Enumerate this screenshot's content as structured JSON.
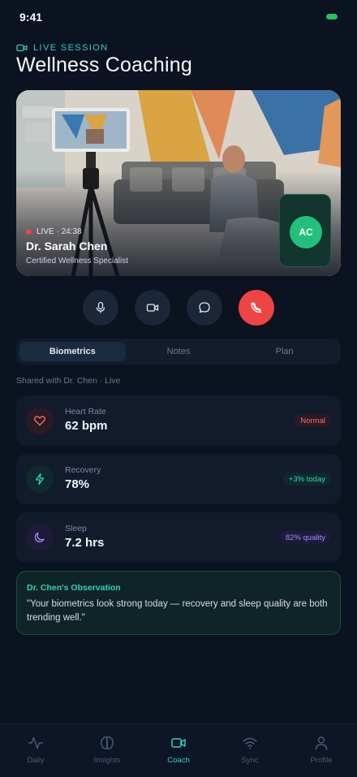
{
  "status_bar": {
    "time": "9:41"
  },
  "header": {
    "session_tag": "LIVE SESSION",
    "title": "Wellness Coaching"
  },
  "video": {
    "live_label": "LIVE · 24:38",
    "coach_name": "Dr. Sarah Chen",
    "coach_title": "Certified Wellness Specialist",
    "self_initials": "AC"
  },
  "controls": {
    "mic_icon": "microphone-icon",
    "camera_icon": "video-camera-icon",
    "chat_icon": "chat-bubble-icon",
    "end_icon": "phone-off-icon"
  },
  "tabs": [
    {
      "label": "Biometrics",
      "active": true
    },
    {
      "label": "Notes",
      "active": false
    },
    {
      "label": "Plan",
      "active": false
    }
  ],
  "shared_caption": "Shared with Dr. Chen · Live",
  "metrics": [
    {
      "icon": "heart-icon",
      "label": "Heart Rate",
      "value": "62 bpm",
      "badge": "Normal",
      "badge_color": "#f87171"
    },
    {
      "icon": "lightning-icon",
      "label": "Recovery",
      "value": "78%",
      "badge": "+3% today",
      "badge_color": "#2dd4bf"
    },
    {
      "icon": "moon-icon",
      "label": "Sleep",
      "value": "7.2 hrs",
      "badge": "82% quality",
      "badge_color": "#a78bfa"
    }
  ],
  "observation": {
    "title": "Dr. Chen's Observation",
    "text": "\"Your biometrics look strong today — recovery and sleep quality are both trending well.\""
  },
  "bottom_nav": [
    {
      "label": "Daily",
      "icon": "activity-icon",
      "active": false
    },
    {
      "label": "Insights",
      "icon": "brain-icon",
      "active": false
    },
    {
      "label": "Coach",
      "icon": "video-camera-icon",
      "active": true
    },
    {
      "label": "Sync",
      "icon": "wifi-icon",
      "active": false
    },
    {
      "label": "Profile",
      "icon": "user-icon",
      "active": false
    }
  ],
  "colors": {
    "accent": "#2dd4bf",
    "end_call": "#ef4444",
    "background": "#0b1220"
  }
}
